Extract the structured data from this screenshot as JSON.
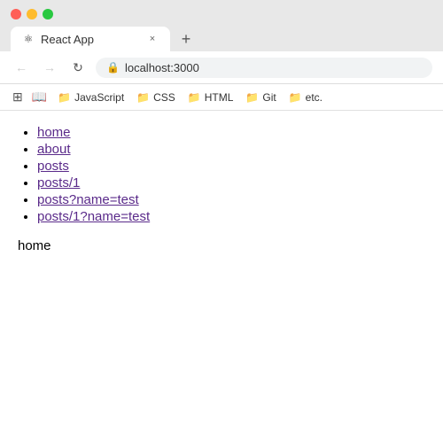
{
  "browser": {
    "tab_title": "React App",
    "favicon": "⚛",
    "tab_close": "×",
    "new_tab": "+",
    "back_btn": "←",
    "forward_btn": "→",
    "reload_btn": "↻",
    "address": "localhost:3000",
    "lock_symbol": "🔒"
  },
  "bookmarks": [
    {
      "id": "apps",
      "icon": "⊞",
      "label": ""
    },
    {
      "id": "reading",
      "icon": "📖",
      "label": ""
    },
    {
      "id": "javascript",
      "icon": "📁",
      "label": "JavaScript"
    },
    {
      "id": "css",
      "icon": "📁",
      "label": "CSS"
    },
    {
      "id": "html",
      "icon": "📁",
      "label": "HTML"
    },
    {
      "id": "git",
      "icon": "📁",
      "label": "Git"
    },
    {
      "id": "etc",
      "icon": "📁",
      "label": "etc."
    }
  ],
  "nav_links": [
    {
      "id": "home-link",
      "text": "home",
      "href": "/"
    },
    {
      "id": "about-link",
      "text": "about",
      "href": "/about"
    },
    {
      "id": "posts-link",
      "text": "posts",
      "href": "/posts"
    },
    {
      "id": "posts-1-link",
      "text": "posts/1",
      "href": "/posts/1"
    },
    {
      "id": "posts-query-link",
      "text": "posts?name=test",
      "href": "/posts?name=test"
    },
    {
      "id": "posts-1-query-link",
      "text": "posts/1?name=test",
      "href": "/posts/1?name=test"
    }
  ],
  "page_content_label": "home"
}
